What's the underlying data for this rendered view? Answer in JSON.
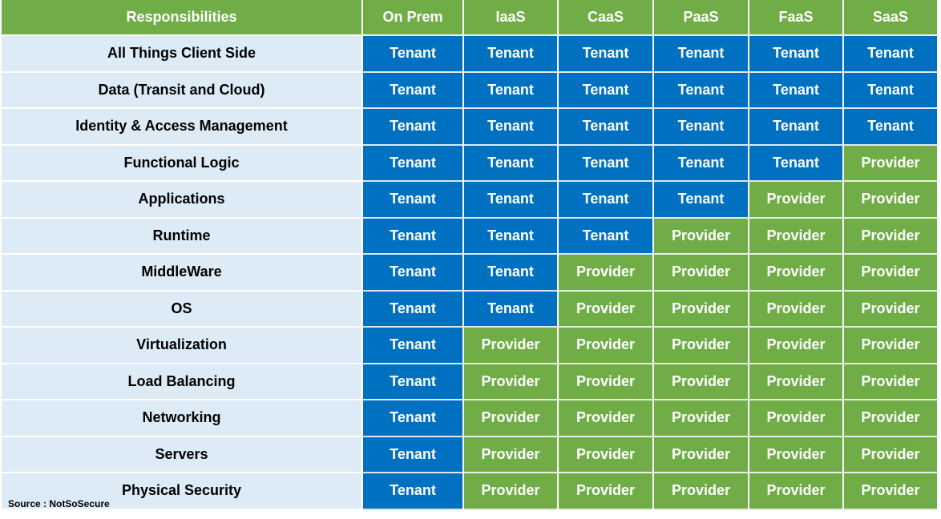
{
  "title_header": "Responsibilities",
  "columns": [
    "On Prem",
    "IaaS",
    "CaaS",
    "PaaS",
    "FaaS",
    "SaaS"
  ],
  "colors": {
    "tenant": "#0070C0",
    "provider": "#70AD47",
    "header": "#70AD47",
    "row_label_bg": "#DDEBF7"
  },
  "rows": [
    {
      "label": "All  Things Client Side",
      "values": [
        "Tenant",
        "Tenant",
        "Tenant",
        "Tenant",
        "Tenant",
        "Tenant"
      ]
    },
    {
      "label": "Data (Transit and Cloud)",
      "values": [
        "Tenant",
        "Tenant",
        "Tenant",
        "Tenant",
        "Tenant",
        "Tenant"
      ]
    },
    {
      "label": "Identity & Access Management",
      "values": [
        "Tenant",
        "Tenant",
        "Tenant",
        "Tenant",
        "Tenant",
        "Tenant"
      ]
    },
    {
      "label": "Functional Logic",
      "values": [
        "Tenant",
        "Tenant",
        "Tenant",
        "Tenant",
        "Tenant",
        "Provider"
      ]
    },
    {
      "label": "Applications",
      "values": [
        "Tenant",
        "Tenant",
        "Tenant",
        "Tenant",
        "Provider",
        "Provider"
      ]
    },
    {
      "label": "Runtime",
      "values": [
        "Tenant",
        "Tenant",
        "Tenant",
        "Provider",
        "Provider",
        "Provider"
      ]
    },
    {
      "label": "MiddleWare",
      "values": [
        "Tenant",
        "Tenant",
        "Provider",
        "Provider",
        "Provider",
        "Provider"
      ]
    },
    {
      "label": "OS",
      "values": [
        "Tenant",
        "Tenant",
        "Provider",
        "Provider",
        "Provider",
        "Provider"
      ]
    },
    {
      "label": "Virtualization",
      "values": [
        "Tenant",
        "Provider",
        "Provider",
        "Provider",
        "Provider",
        "Provider"
      ]
    },
    {
      "label": "Load Balancing",
      "values": [
        "Tenant",
        "Provider",
        "Provider",
        "Provider",
        "Provider",
        "Provider"
      ]
    },
    {
      "label": "Networking",
      "values": [
        "Tenant",
        "Provider",
        "Provider",
        "Provider",
        "Provider",
        "Provider"
      ]
    },
    {
      "label": "Servers",
      "values": [
        "Tenant",
        "Provider",
        "Provider",
        "Provider",
        "Provider",
        "Provider"
      ]
    },
    {
      "label": "Physical Security",
      "values": [
        "Tenant",
        "Provider",
        "Provider",
        "Provider",
        "Provider",
        "Provider"
      ]
    }
  ],
  "source": "Source : NotSoSecure"
}
